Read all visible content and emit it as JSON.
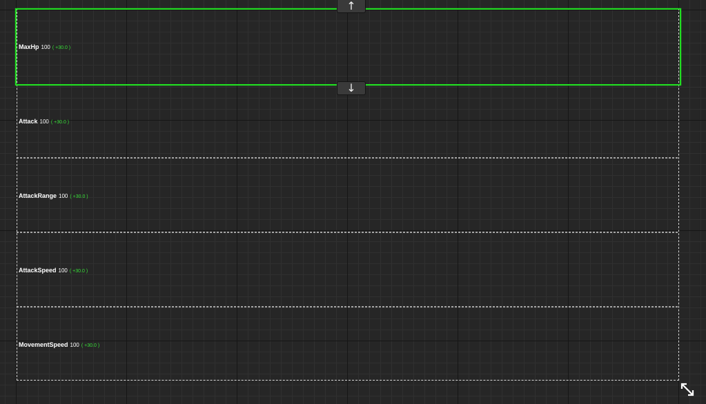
{
  "buttons": {
    "move_up": "↑",
    "move_down": "↓"
  },
  "stats": [
    {
      "name": "MaxHp",
      "value": "100",
      "bonus": "( +30.0 )"
    },
    {
      "name": "Attack",
      "value": "100",
      "bonus": "( +30.0 )"
    },
    {
      "name": "AttackRange",
      "value": "100",
      "bonus": "( +30.0 )"
    },
    {
      "name": "AttackSpeed",
      "value": "100",
      "bonus": "( +30.0 )"
    },
    {
      "name": "MovementSpeed",
      "value": "100",
      "bonus": "( +30.0 )"
    }
  ],
  "colors": {
    "selection": "#22dd22",
    "bonus_text": "#38e038",
    "canvas_background": "#262626"
  },
  "icons": {
    "resize": "resize-diagonal-icon"
  }
}
